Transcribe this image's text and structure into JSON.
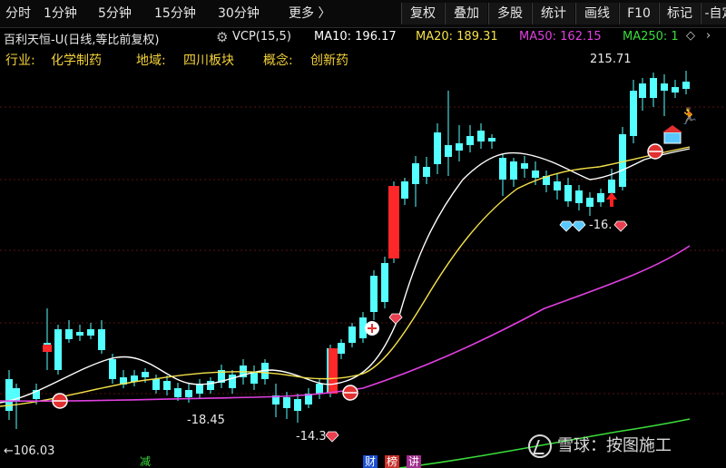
{
  "toolbar": {
    "periods": [
      "分时",
      "1分钟",
      "5分钟",
      "15分钟",
      "30分钟",
      "更多 〉"
    ],
    "buttons": [
      "复权",
      "叠加",
      "多股",
      "统计",
      "画线",
      "F10",
      "标记",
      "-自定"
    ]
  },
  "infobar": {
    "title": "百利天恒-U(日线,等比前复权)",
    "indicator": "VCP(15,5)",
    "ma10": "MA10: 196.17",
    "ma20": "MA20: 189.31",
    "ma50": "MA50: 162.15",
    "ma250": "MA250: 1",
    "colors": {
      "ma10": "#ffffff",
      "ma20": "#f5e14a",
      "ma50": "#e040e0",
      "ma250": "#3adc3a"
    }
  },
  "industry": {
    "industry_label": "行业:",
    "industry_value": "化学制药",
    "region_label": "地域:",
    "region_value": "四川板块",
    "concept_label": "概念:",
    "concept_value": "创新药"
  },
  "annotations": {
    "high": "215.71",
    "low1": "-18.45",
    "low2": "-14.3",
    "low3": "-16.",
    "bottom": "←106.03"
  },
  "bottom_tags": [
    "减",
    "财",
    "榜",
    "讲"
  ],
  "watermark": "雪球：按图施工",
  "colors": {
    "up": "#ff2828",
    "down": "#54ffff",
    "bg": "#000000"
  }
}
